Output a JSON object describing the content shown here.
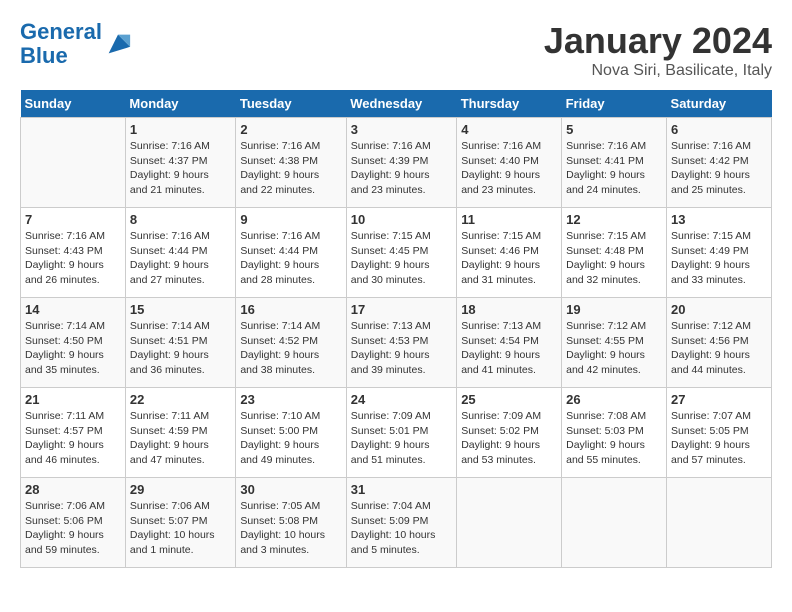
{
  "header": {
    "logo_line1": "General",
    "logo_line2": "Blue",
    "month": "January 2024",
    "location": "Nova Siri, Basilicate, Italy"
  },
  "days_header": [
    "Sunday",
    "Monday",
    "Tuesday",
    "Wednesday",
    "Thursday",
    "Friday",
    "Saturday"
  ],
  "weeks": [
    [
      {
        "day": "",
        "info": ""
      },
      {
        "day": "1",
        "info": "Sunrise: 7:16 AM\nSunset: 4:37 PM\nDaylight: 9 hours\nand 21 minutes."
      },
      {
        "day": "2",
        "info": "Sunrise: 7:16 AM\nSunset: 4:38 PM\nDaylight: 9 hours\nand 22 minutes."
      },
      {
        "day": "3",
        "info": "Sunrise: 7:16 AM\nSunset: 4:39 PM\nDaylight: 9 hours\nand 23 minutes."
      },
      {
        "day": "4",
        "info": "Sunrise: 7:16 AM\nSunset: 4:40 PM\nDaylight: 9 hours\nand 23 minutes."
      },
      {
        "day": "5",
        "info": "Sunrise: 7:16 AM\nSunset: 4:41 PM\nDaylight: 9 hours\nand 24 minutes."
      },
      {
        "day": "6",
        "info": "Sunrise: 7:16 AM\nSunset: 4:42 PM\nDaylight: 9 hours\nand 25 minutes."
      }
    ],
    [
      {
        "day": "7",
        "info": "Sunrise: 7:16 AM\nSunset: 4:43 PM\nDaylight: 9 hours\nand 26 minutes."
      },
      {
        "day": "8",
        "info": "Sunrise: 7:16 AM\nSunset: 4:44 PM\nDaylight: 9 hours\nand 27 minutes."
      },
      {
        "day": "9",
        "info": "Sunrise: 7:16 AM\nSunset: 4:44 PM\nDaylight: 9 hours\nand 28 minutes."
      },
      {
        "day": "10",
        "info": "Sunrise: 7:15 AM\nSunset: 4:45 PM\nDaylight: 9 hours\nand 30 minutes."
      },
      {
        "day": "11",
        "info": "Sunrise: 7:15 AM\nSunset: 4:46 PM\nDaylight: 9 hours\nand 31 minutes."
      },
      {
        "day": "12",
        "info": "Sunrise: 7:15 AM\nSunset: 4:48 PM\nDaylight: 9 hours\nand 32 minutes."
      },
      {
        "day": "13",
        "info": "Sunrise: 7:15 AM\nSunset: 4:49 PM\nDaylight: 9 hours\nand 33 minutes."
      }
    ],
    [
      {
        "day": "14",
        "info": "Sunrise: 7:14 AM\nSunset: 4:50 PM\nDaylight: 9 hours\nand 35 minutes."
      },
      {
        "day": "15",
        "info": "Sunrise: 7:14 AM\nSunset: 4:51 PM\nDaylight: 9 hours\nand 36 minutes."
      },
      {
        "day": "16",
        "info": "Sunrise: 7:14 AM\nSunset: 4:52 PM\nDaylight: 9 hours\nand 38 minutes."
      },
      {
        "day": "17",
        "info": "Sunrise: 7:13 AM\nSunset: 4:53 PM\nDaylight: 9 hours\nand 39 minutes."
      },
      {
        "day": "18",
        "info": "Sunrise: 7:13 AM\nSunset: 4:54 PM\nDaylight: 9 hours\nand 41 minutes."
      },
      {
        "day": "19",
        "info": "Sunrise: 7:12 AM\nSunset: 4:55 PM\nDaylight: 9 hours\nand 42 minutes."
      },
      {
        "day": "20",
        "info": "Sunrise: 7:12 AM\nSunset: 4:56 PM\nDaylight: 9 hours\nand 44 minutes."
      }
    ],
    [
      {
        "day": "21",
        "info": "Sunrise: 7:11 AM\nSunset: 4:57 PM\nDaylight: 9 hours\nand 46 minutes."
      },
      {
        "day": "22",
        "info": "Sunrise: 7:11 AM\nSunset: 4:59 PM\nDaylight: 9 hours\nand 47 minutes."
      },
      {
        "day": "23",
        "info": "Sunrise: 7:10 AM\nSunset: 5:00 PM\nDaylight: 9 hours\nand 49 minutes."
      },
      {
        "day": "24",
        "info": "Sunrise: 7:09 AM\nSunset: 5:01 PM\nDaylight: 9 hours\nand 51 minutes."
      },
      {
        "day": "25",
        "info": "Sunrise: 7:09 AM\nSunset: 5:02 PM\nDaylight: 9 hours\nand 53 minutes."
      },
      {
        "day": "26",
        "info": "Sunrise: 7:08 AM\nSunset: 5:03 PM\nDaylight: 9 hours\nand 55 minutes."
      },
      {
        "day": "27",
        "info": "Sunrise: 7:07 AM\nSunset: 5:05 PM\nDaylight: 9 hours\nand 57 minutes."
      }
    ],
    [
      {
        "day": "28",
        "info": "Sunrise: 7:06 AM\nSunset: 5:06 PM\nDaylight: 9 hours\nand 59 minutes."
      },
      {
        "day": "29",
        "info": "Sunrise: 7:06 AM\nSunset: 5:07 PM\nDaylight: 10 hours\nand 1 minute."
      },
      {
        "day": "30",
        "info": "Sunrise: 7:05 AM\nSunset: 5:08 PM\nDaylight: 10 hours\nand 3 minutes."
      },
      {
        "day": "31",
        "info": "Sunrise: 7:04 AM\nSunset: 5:09 PM\nDaylight: 10 hours\nand 5 minutes."
      },
      {
        "day": "",
        "info": ""
      },
      {
        "day": "",
        "info": ""
      },
      {
        "day": "",
        "info": ""
      }
    ]
  ]
}
